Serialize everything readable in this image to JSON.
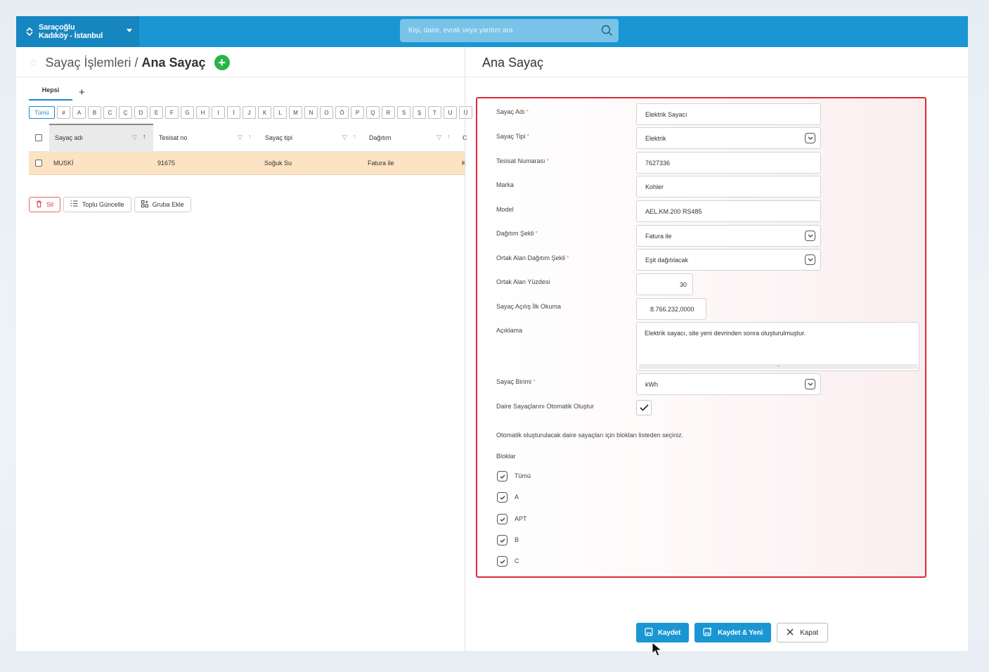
{
  "topbar": {
    "site_name": "Saraçoğlu",
    "site_location": "Kadıköy - İstanbul",
    "search_placeholder": "Kişi, daire, evrak veya yardım ara"
  },
  "left": {
    "breadcrumb_parent": "Sayaç İşlemleri",
    "breadcrumb_sep": "/",
    "breadcrumb_current": "Ana Sayaç",
    "add_symbol": "+",
    "tabs": [
      {
        "label": "Hepsi"
      }
    ],
    "tab_add": "+",
    "alpha_filter": [
      "Tümü",
      "#",
      "A",
      "B",
      "C",
      "Ç",
      "D",
      "E",
      "F",
      "G",
      "H",
      "I",
      "İ",
      "J",
      "K",
      "L",
      "M",
      "N",
      "O",
      "Ö",
      "P",
      "Q",
      "R",
      "S",
      "Ş",
      "T",
      "U",
      "Ü"
    ],
    "columns": [
      "Sayaç adı",
      "Tesisat no",
      "Sayaç tipi",
      "Dağıtım",
      "C"
    ],
    "rows": [
      {
        "name": "MUSKİ",
        "tesisat": "91675",
        "tip": "Soğuk Su",
        "dagitim": "Fatura ile",
        "extra": "K"
      }
    ],
    "actions": {
      "delete": "Sil",
      "bulk_update": "Toplu Güncelle",
      "add_group": "Gruba Ekle"
    }
  },
  "right": {
    "title": "Ana Sayaç",
    "form": {
      "sayac_adi": {
        "label": "Sayaç Adı",
        "value": "Elektrik Sayacı"
      },
      "sayac_tipi": {
        "label": "Sayaç Tipi",
        "value": "Elektrik"
      },
      "tesisat_numarasi": {
        "label": "Tesisat Numarası",
        "value": "7627336"
      },
      "marka": {
        "label": "Marka",
        "value": "Kohler"
      },
      "model": {
        "label": "Model",
        "value": "AEL.KM.200 RS485"
      },
      "dagitim_sekli": {
        "label": "Dağıtım Şekli",
        "value": "Fatura ile"
      },
      "ortak_alan_dagitim": {
        "label": "Ortak Alan Dağıtım Şekli",
        "value": "Eşit dağıtılacak"
      },
      "ortak_alan_yuzdesi": {
        "label": "Ortak Alan Yüzdesi",
        "value": "30"
      },
      "ilk_okuma": {
        "label": "Sayaç Açılış İlk Okuma",
        "value": "8.766.232,0000"
      },
      "aciklama": {
        "label": "Açıklama",
        "value": "Elektrik sayacı, site yeni devrinden sonra oluşturulmuştur."
      },
      "sayac_birimi": {
        "label": "Sayaç Birimi",
        "value": "kWh"
      },
      "otomatik_olustur": {
        "label": "Daire Sayaçlarını Otomatik Oluştur",
        "checked": true
      },
      "note": "Otomatik oluşturulacak daire sayaçları için blokları listeden seçiniz.",
      "bloklar_label": "Bloklar",
      "bloklar": [
        {
          "label": "Tümü",
          "checked": true
        },
        {
          "label": "A",
          "checked": true
        },
        {
          "label": "APT",
          "checked": true
        },
        {
          "label": "B",
          "checked": true
        },
        {
          "label": "C",
          "checked": true
        }
      ],
      "required_mark": "*"
    },
    "buttons": {
      "save": "Kaydet",
      "save_new": "Kaydet & Yeni",
      "close": "Kapat"
    }
  },
  "colors": {
    "topbar": "#1a96d3",
    "accent": "#1a86c9",
    "highlight_row": "#fbe3c3",
    "form_border": "#dd2b37",
    "add_button": "#28b446",
    "required": "#f0a020"
  }
}
